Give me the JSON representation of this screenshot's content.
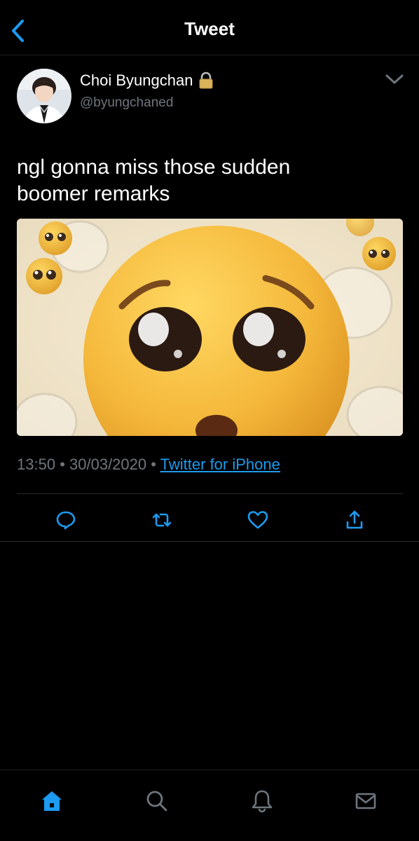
{
  "header": {
    "title": "Tweet",
    "back_icon": "chevron-left-icon"
  },
  "author": {
    "name": "Choi Byungchan",
    "handle": "@byungchaned",
    "protected_icon": "lock-icon",
    "more_icon": "chevron-down-icon"
  },
  "tweet": {
    "text": "ngl gonna miss those sudden\nboomer remarks",
    "media_description_icon": "pleading-face-emoji-image"
  },
  "meta": {
    "time": "13:50",
    "date": "30/03/2020",
    "separator": "•",
    "source": "Twitter for iPhone"
  },
  "actions": {
    "reply_icon": "reply-icon",
    "retweet_icon": "retweet-icon",
    "like_icon": "heart-icon",
    "share_icon": "share-icon"
  },
  "tabbar": {
    "home_icon": "home-icon",
    "search_icon": "search-icon",
    "notifications_icon": "bell-icon",
    "messages_icon": "mail-icon"
  },
  "colors": {
    "background": "#000000",
    "text": "#ffffff",
    "muted": "#6e767d",
    "accent": "#1d9bf0",
    "icon": "#1d9bf0"
  }
}
